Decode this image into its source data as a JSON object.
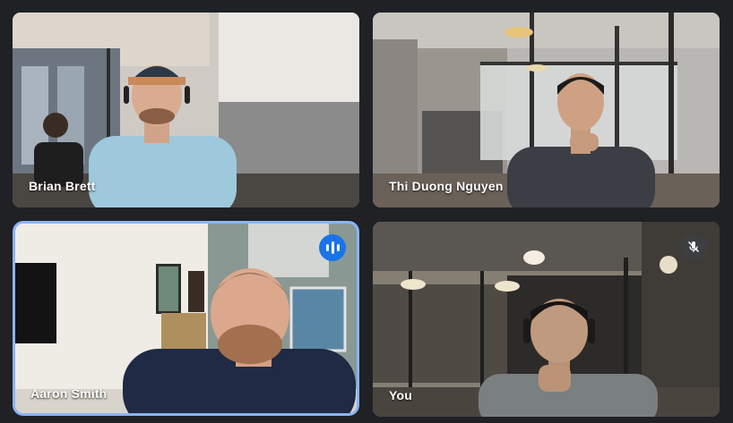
{
  "participants": [
    {
      "name": "Brian Brett",
      "speaking": false,
      "muted": false
    },
    {
      "name": "Thi Duong Nguyen",
      "speaking": false,
      "muted": false
    },
    {
      "name": "Aaron Smith",
      "speaking": true,
      "muted": false
    },
    {
      "name": "You",
      "speaking": false,
      "muted": true
    }
  ],
  "colors": {
    "background": "#202124",
    "active_border": "#8ab4f8",
    "speaking_badge": "#1a73e8",
    "mute_badge": "#3c4043"
  },
  "icons": {
    "speaking": "audio-level-icon",
    "muted": "mic-off-icon"
  }
}
